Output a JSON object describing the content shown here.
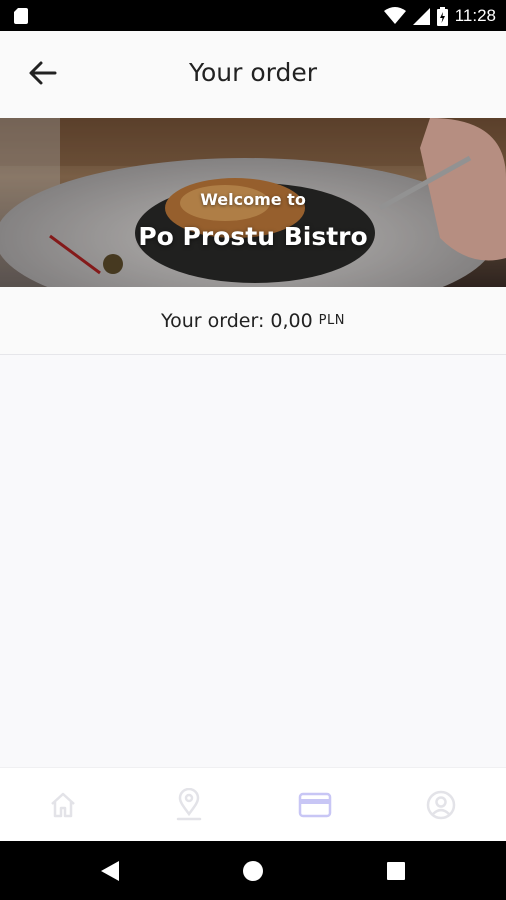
{
  "status_bar": {
    "time": "11:28",
    "icons": [
      "sd-card-icon",
      "wifi-icon",
      "signal-icon",
      "battery-icon"
    ]
  },
  "app_bar": {
    "title": "Your order",
    "back_icon": "arrow-left-icon"
  },
  "hero": {
    "welcome_text": "Welcome to",
    "restaurant_name": "Po Prostu Bistro"
  },
  "order": {
    "label": "Your order:",
    "amount": "0,00",
    "currency": "PLN"
  },
  "bottom_nav": {
    "tabs": [
      {
        "icon": "home-icon",
        "active": false
      },
      {
        "icon": "location-pin-icon",
        "active": false
      },
      {
        "icon": "credit-card-icon",
        "active": true
      },
      {
        "icon": "user-circle-icon",
        "active": false
      }
    ],
    "active_color": "#c8c6f5",
    "inactive_color": "#e3e3e8"
  },
  "system_nav": {
    "buttons": [
      "back-triangle-icon",
      "home-circle-icon",
      "recents-square-icon"
    ]
  }
}
